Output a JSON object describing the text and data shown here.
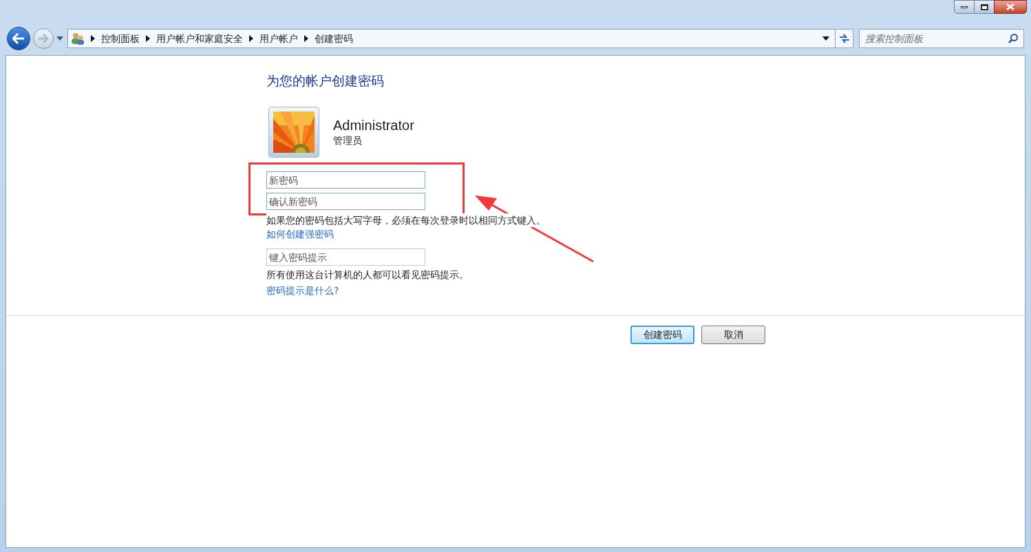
{
  "address_bar": {
    "breadcrumb": [
      "控制面板",
      "用户帐户和家庭安全",
      "用户帐户",
      "创建密码"
    ],
    "search": {
      "placeholder": "搜索控制面板"
    }
  },
  "page": {
    "title": "为您的帐户创建密码",
    "account": {
      "name": "Administrator",
      "role": "管理员"
    },
    "password_fields": [
      {
        "placeholder": "新密码"
      },
      {
        "placeholder": "确认新密码"
      }
    ],
    "case_note": "如果您的密码包括大写字母，必须在每次登录时以相同方式键入。",
    "strong_link": "如何创建强密码",
    "hint_field": {
      "placeholder": "键入密码提示"
    },
    "hint_note": "所有使用这台计算机的人都可以看见密码提示。",
    "hint_link": "密码提示是什么?"
  },
  "buttons": [
    {
      "label": "创建密码",
      "default": true
    },
    {
      "label": "取消",
      "default": false
    }
  ]
}
